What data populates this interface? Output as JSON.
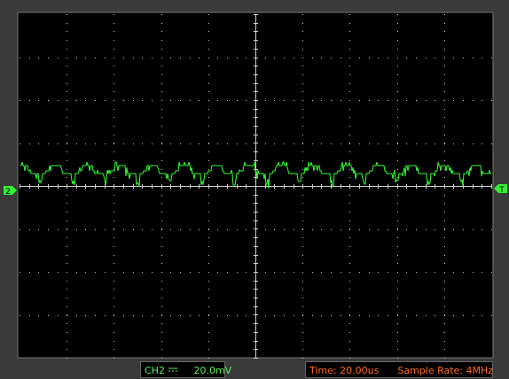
{
  "screen": {
    "background": "#3a3a3a",
    "grid_background": "#000000",
    "grid_dot_color": "#c8c8c8",
    "trace_color": "#33ff33",
    "horizontal_divisions": 10,
    "vertical_divisions": 8
  },
  "markers": {
    "channel_marker_label": "2",
    "trigger_marker_label": "T"
  },
  "status_bar": {
    "channel_label": "CH2",
    "coupling_icon": "dc-coupling-icon",
    "volts_per_div": "20.0mV",
    "time_label": "Time:",
    "time_per_div": "20.00us",
    "sample_rate_label": "Sample Rate:",
    "sample_rate_value": "4MHz"
  }
}
